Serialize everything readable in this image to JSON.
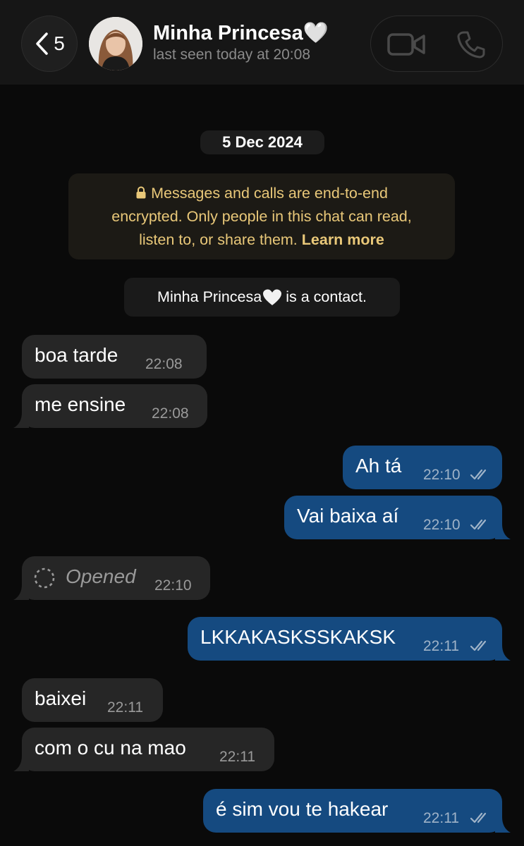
{
  "header": {
    "back_count": "5",
    "contact_name": "Minha Princesa🤍",
    "last_seen": "last seen today at 20:08",
    "icons": {
      "back": "chevron-left-icon",
      "video": "video-call-icon",
      "phone": "phone-call-icon"
    }
  },
  "chat": {
    "date": "5 Dec 2024",
    "encryption_notice": {
      "line1": "Messages and calls are end-to-end",
      "line2": "encrypted. Only people in this chat can read,",
      "line3_pre": "listen to, or share them. ",
      "learn_more": "Learn more"
    },
    "contact_notice": {
      "name": "Minha Princesa",
      "suffix": " is a contact."
    },
    "messages": [
      {
        "dir": "in",
        "text": "boa tarde",
        "time": "22:08"
      },
      {
        "dir": "in",
        "text": "me ensine",
        "time": "22:08"
      },
      {
        "dir": "out",
        "text": "Ah tá",
        "time": "22:10",
        "status": "read"
      },
      {
        "dir": "out",
        "text": "Vai baixa aí",
        "time": "22:10",
        "status": "read"
      },
      {
        "dir": "in",
        "text": "Opened",
        "time": "22:10",
        "type": "view-once"
      },
      {
        "dir": "out",
        "text": "LKKAKASKSSKAKSK",
        "time": "22:11",
        "status": "read"
      },
      {
        "dir": "in",
        "text": "baixei",
        "time": "22:11"
      },
      {
        "dir": "in",
        "text": "com o cu na mao",
        "time": "22:11"
      },
      {
        "dir": "out",
        "text": "é sim vou te hakear",
        "time": "22:11",
        "status": "read"
      }
    ]
  },
  "colors": {
    "background": "#0a0a0a",
    "incoming_bubble": "#262626",
    "outgoing_bubble": "#154a80",
    "encryption_text": "#e9c879"
  }
}
